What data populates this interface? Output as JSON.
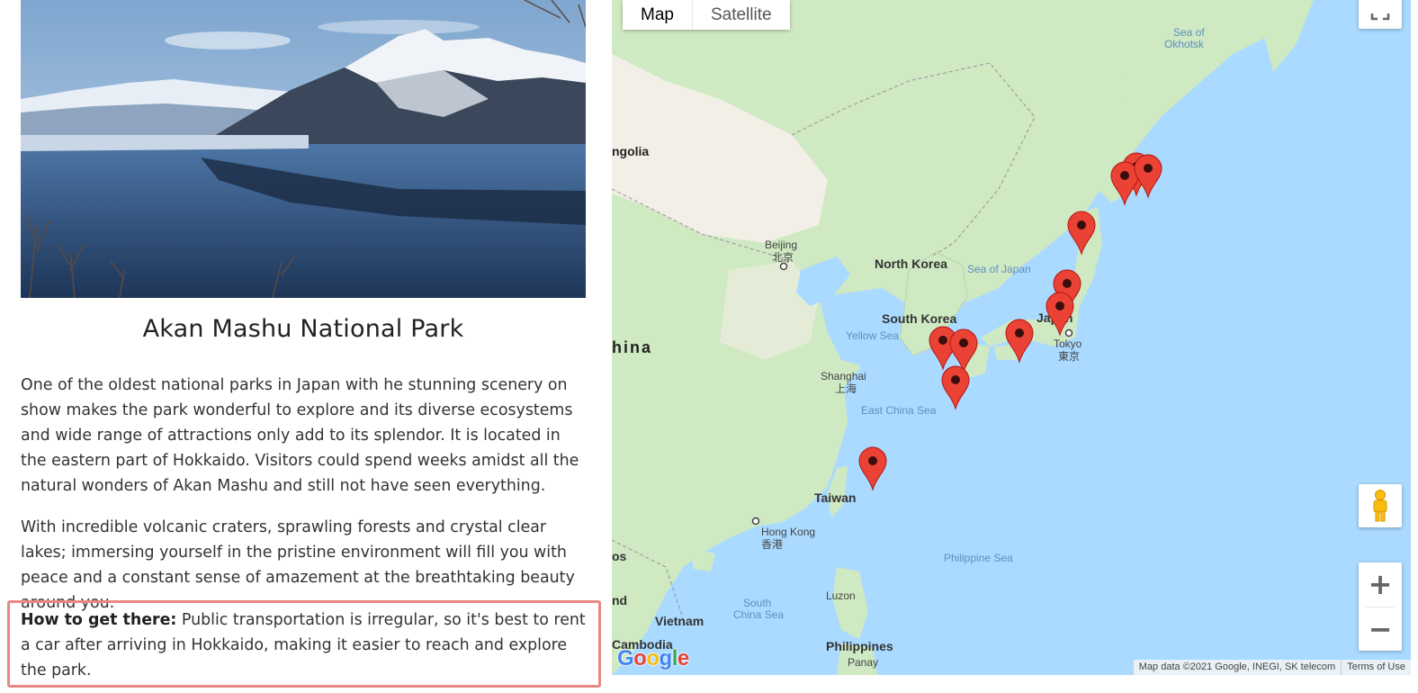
{
  "article": {
    "image_alt": "Snowy volcanic lake with forested mountains",
    "title": "Akan Mashu National Park",
    "paragraphs": [
      "One of the oldest national parks in Japan with he stunning scenery on show makes the park wonderful to explore and its diverse ecosystems and wide range of attractions only add to its splendor. It is located in the eastern part of Hokkaido. Visitors could spend weeks amidst all the natural wonders of Akan Mashu and still not have seen everything.",
      "With incredible volcanic craters, sprawling forests and crystal clear lakes; immersing yourself in the pristine environment will fill you with peace and a constant sense of amazement at the breathtaking beauty around you."
    ],
    "how_to_label": "How to get there:",
    "how_to_text": " Public transportation is irregular, so it's best to rent a car after arriving in Hokkaido, making it easier to reach and explore the park."
  },
  "map": {
    "type_buttons": {
      "map": "Map",
      "satellite": "Satellite",
      "selected": "Map"
    },
    "labels": {
      "mongolia": "ngolia",
      "china": "hina",
      "north_korea": "North Korea",
      "south_korea": "South Korea",
      "japan": "Japan",
      "taiwan": "Taiwan",
      "vietnam": "Vietnam",
      "cambodia": "Cambodia",
      "philippines": "Philippines",
      "laos": "os",
      "hainan_fragment": "nd",
      "beijing": "Beijing",
      "beijing_cjk": "北京",
      "shanghai": "Shanghai",
      "shanghai_cjk": "上海",
      "tokyo": "Tokyo",
      "tokyo_cjk": "東京",
      "hong_kong": "Hong Kong",
      "hong_kong_cjk": "香港",
      "luzon": "Luzon",
      "panay": "Panay",
      "sea_of_okhotsk_1": "Sea of",
      "sea_of_okhotsk_2": "Okhotsk",
      "sea_of_japan": "Sea of Japan",
      "yellow_sea": "Yellow Sea",
      "east_china_sea": "East China Sea",
      "philippine_sea": "Philippine Sea",
      "south_china_sea_1": "South",
      "south_china_sea_2": "China Sea"
    },
    "marker_count": 11,
    "zoom_in": "+",
    "zoom_out": "−",
    "logo": "Google",
    "attribution": "Map data ©2021 Google, INEGI, SK telecom",
    "terms": "Terms of Use",
    "colors": {
      "water": "#aadaff",
      "land": "#cfe9c3",
      "land_dry": "#f2efe6",
      "marker": "#ea4335",
      "highlight_border": "#e88883"
    }
  }
}
